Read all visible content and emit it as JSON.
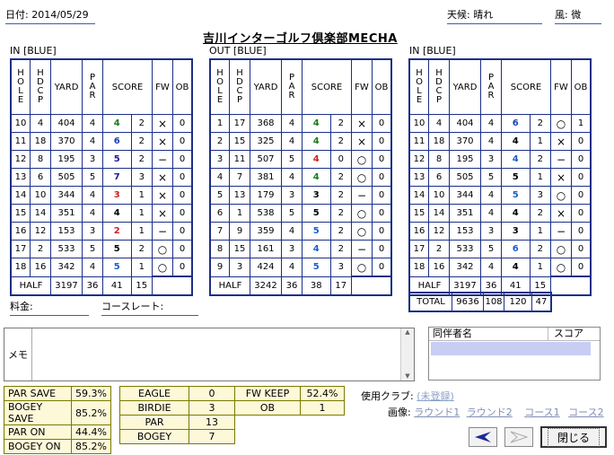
{
  "header": {
    "date_label": "日付: 2014/05/29",
    "weather_label": "天候: 晴れ",
    "wind_label": "風: 微",
    "course_title": "吉川インターゴルフ倶楽部MECHA"
  },
  "columns": {
    "hole": "HOLE",
    "hdcp": "HDCP",
    "yard": "YARD",
    "par": "PAR",
    "score": "SCORE",
    "fw": "FW",
    "ob": "OB"
  },
  "sections": [
    {
      "title": "IN [BLUE]",
      "rows": [
        {
          "hole": "10",
          "hdcp": "4",
          "yard": "404",
          "par": "4",
          "score": "4",
          "putt": "2",
          "fw": "×",
          "ob": "0",
          "score_color": "#1a7a1a"
        },
        {
          "hole": "11",
          "hdcp": "18",
          "yard": "370",
          "par": "4",
          "score": "6",
          "putt": "2",
          "fw": "×",
          "ob": "0",
          "score_color": "#1a3fb8"
        },
        {
          "hole": "12",
          "hdcp": "8",
          "yard": "195",
          "par": "3",
          "score": "5",
          "putt": "2",
          "fw": "−",
          "ob": "0",
          "score_color": "#1a1a9a"
        },
        {
          "hole": "13",
          "hdcp": "6",
          "yard": "505",
          "par": "5",
          "score": "7",
          "putt": "3",
          "fw": "×",
          "ob": "0",
          "score_color": "#1a1a9a"
        },
        {
          "hole": "14",
          "hdcp": "10",
          "yard": "344",
          "par": "4",
          "score": "3",
          "putt": "1",
          "fw": "×",
          "ob": "0",
          "score_color": "#d02020"
        },
        {
          "hole": "15",
          "hdcp": "14",
          "yard": "351",
          "par": "4",
          "score": "4",
          "putt": "1",
          "fw": "×",
          "ob": "0",
          "score_color": "#000000"
        },
        {
          "hole": "16",
          "hdcp": "12",
          "yard": "153",
          "par": "3",
          "score": "2",
          "putt": "1",
          "fw": "−",
          "ob": "0",
          "score_color": "#d02020"
        },
        {
          "hole": "17",
          "hdcp": "2",
          "yard": "533",
          "par": "5",
          "score": "5",
          "putt": "2",
          "fw": "○",
          "ob": "0",
          "score_color": "#000000"
        },
        {
          "hole": "18",
          "hdcp": "16",
          "yard": "342",
          "par": "4",
          "score": "5",
          "putt": "1",
          "fw": "○",
          "ob": "0",
          "score_color": "#1a5fc8"
        }
      ],
      "half": {
        "label": "HALF",
        "yard": "3197",
        "par": "36",
        "score": "41",
        "putt": "15"
      }
    },
    {
      "title": "OUT [BLUE]",
      "rows": [
        {
          "hole": "1",
          "hdcp": "17",
          "yard": "368",
          "par": "4",
          "score": "4",
          "putt": "2",
          "fw": "×",
          "ob": "0",
          "score_color": "#1a7a1a"
        },
        {
          "hole": "2",
          "hdcp": "15",
          "yard": "325",
          "par": "4",
          "score": "4",
          "putt": "2",
          "fw": "×",
          "ob": "0",
          "score_color": "#1a7a1a"
        },
        {
          "hole": "3",
          "hdcp": "11",
          "yard": "507",
          "par": "5",
          "score": "4",
          "putt": "0",
          "fw": "○",
          "ob": "0",
          "score_color": "#d02020"
        },
        {
          "hole": "4",
          "hdcp": "7",
          "yard": "381",
          "par": "4",
          "score": "4",
          "putt": "2",
          "fw": "○",
          "ob": "0",
          "score_color": "#1a7a1a"
        },
        {
          "hole": "5",
          "hdcp": "13",
          "yard": "179",
          "par": "3",
          "score": "3",
          "putt": "2",
          "fw": "−",
          "ob": "0",
          "score_color": "#000000"
        },
        {
          "hole": "6",
          "hdcp": "1",
          "yard": "538",
          "par": "5",
          "score": "5",
          "putt": "2",
          "fw": "○",
          "ob": "0",
          "score_color": "#000000"
        },
        {
          "hole": "7",
          "hdcp": "9",
          "yard": "359",
          "par": "4",
          "score": "5",
          "putt": "2",
          "fw": "○",
          "ob": "0",
          "score_color": "#1a5fc8"
        },
        {
          "hole": "8",
          "hdcp": "15",
          "yard": "161",
          "par": "3",
          "score": "4",
          "putt": "2",
          "fw": "−",
          "ob": "0",
          "score_color": "#1a5fc8"
        },
        {
          "hole": "9",
          "hdcp": "3",
          "yard": "424",
          "par": "4",
          "score": "5",
          "putt": "3",
          "fw": "○",
          "ob": "0",
          "score_color": "#1a5fc8"
        }
      ],
      "half": {
        "label": "HALF",
        "yard": "3242",
        "par": "36",
        "score": "38",
        "putt": "17"
      }
    },
    {
      "title": "IN [BLUE]",
      "rows": [
        {
          "hole": "10",
          "hdcp": "4",
          "yard": "404",
          "par": "4",
          "score": "6",
          "putt": "2",
          "fw": "○",
          "ob": "1",
          "score_color": "#1a3fb8"
        },
        {
          "hole": "11",
          "hdcp": "18",
          "yard": "370",
          "par": "4",
          "score": "4",
          "putt": "1",
          "fw": "×",
          "ob": "0",
          "score_color": "#000000"
        },
        {
          "hole": "12",
          "hdcp": "8",
          "yard": "195",
          "par": "3",
          "score": "4",
          "putt": "2",
          "fw": "−",
          "ob": "0",
          "score_color": "#1a5fc8"
        },
        {
          "hole": "13",
          "hdcp": "6",
          "yard": "505",
          "par": "5",
          "score": "5",
          "putt": "1",
          "fw": "×",
          "ob": "0",
          "score_color": "#000000"
        },
        {
          "hole": "14",
          "hdcp": "10",
          "yard": "344",
          "par": "4",
          "score": "5",
          "putt": "3",
          "fw": "○",
          "ob": "0",
          "score_color": "#1a5fc8"
        },
        {
          "hole": "15",
          "hdcp": "14",
          "yard": "351",
          "par": "4",
          "score": "4",
          "putt": "2",
          "fw": "×",
          "ob": "0",
          "score_color": "#000000"
        },
        {
          "hole": "16",
          "hdcp": "12",
          "yard": "153",
          "par": "3",
          "score": "3",
          "putt": "1",
          "fw": "−",
          "ob": "0",
          "score_color": "#000000"
        },
        {
          "hole": "17",
          "hdcp": "2",
          "yard": "533",
          "par": "5",
          "score": "6",
          "putt": "2",
          "fw": "○",
          "ob": "0",
          "score_color": "#1a5fc8"
        },
        {
          "hole": "18",
          "hdcp": "16",
          "yard": "342",
          "par": "4",
          "score": "4",
          "putt": "1",
          "fw": "○",
          "ob": "0",
          "score_color": "#000000"
        }
      ],
      "half": {
        "label": "HALF",
        "yard": "3197",
        "par": "36",
        "score": "41",
        "putt": "15"
      }
    }
  ],
  "total": {
    "label": "TOTAL",
    "yard": "9636",
    "par": "108",
    "score": "120",
    "putt": "47"
  },
  "fee_label": "料金:",
  "course_rate_label": "コースレート:",
  "memo_label": "メモ",
  "companions": {
    "name_header": "同伴者名",
    "score_header": "スコア"
  },
  "stats_left": [
    {
      "label": "PAR SAVE",
      "value": "59.3%"
    },
    {
      "label": "BOGEY SAVE",
      "value": "85.2%"
    },
    {
      "label": "PAR ON",
      "value": "44.4%"
    },
    {
      "label": "BOGEY ON",
      "value": "85.2%"
    }
  ],
  "stats_mid": [
    {
      "label": "EAGLE",
      "value": "0"
    },
    {
      "label": "BIRDIE",
      "value": "3"
    },
    {
      "label": "PAR",
      "value": "13"
    },
    {
      "label": "BOGEY",
      "value": "7"
    }
  ],
  "stats_right": [
    {
      "label": "FW KEEP",
      "value": "52.4%"
    },
    {
      "label": "OB",
      "value": "1"
    }
  ],
  "club_label": "使用クラブ:",
  "club_value": "(未登録)",
  "image_label": "画像:",
  "image_links": [
    "ラウンド1",
    "ラウンド2",
    "コース1",
    "コース2"
  ],
  "close_label": "閉じる",
  "colors": {
    "table_border": "#1c2f86",
    "stat_bg": "#fdf8d8",
    "companion_sel": "#c8cdf4"
  },
  "icons": {
    "prev": "prev-arrow-icon",
    "next": "next-arrow-icon"
  }
}
